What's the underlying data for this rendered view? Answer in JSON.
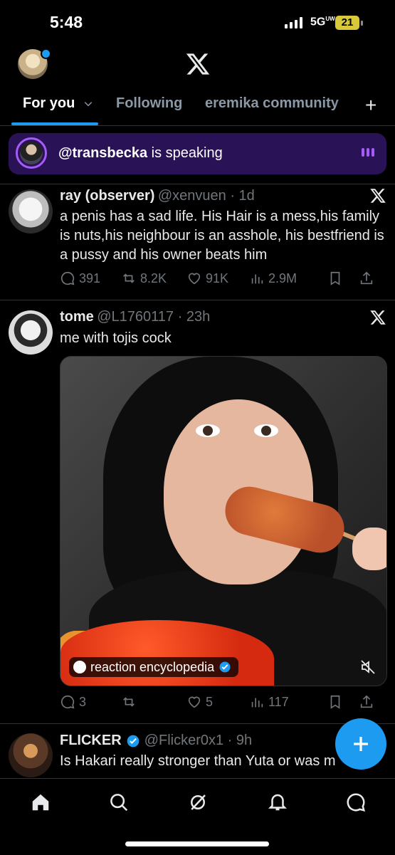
{
  "status_bar": {
    "time": "5:48",
    "network": "5G",
    "network_super": "UW",
    "battery": "21"
  },
  "tabs": [
    {
      "label": "For you",
      "active": true
    },
    {
      "label": "Following",
      "active": false
    },
    {
      "label": "eremika community",
      "active": false
    }
  ],
  "space": {
    "handle": "@transbecka",
    "text": " is speaking"
  },
  "tweets": [
    {
      "name": "ray (observer)",
      "handle": "@xenvuen · 1d",
      "body": "a penis has a sad life. His Hair is a mess,his family is nuts,his neighbour is an asshole, his bestfriend is a pussy and his owner beats him",
      "replies": "391",
      "reposts": "8.2K",
      "likes": "91K",
      "views": "2.9M"
    },
    {
      "name": "tome",
      "handle": "@L1760117 · 23h",
      "body": "me with tojis cock",
      "media_badge": "reaction encyclopedia",
      "replies": "3",
      "reposts": "",
      "likes": "5",
      "views": "117"
    },
    {
      "name": "FLICKER",
      "handle": "@Flicker0x1 · 9h",
      "body": "Is Hakari really stronger than Yuta or was m"
    }
  ],
  "colors": {
    "accent": "#1d9bf0",
    "space_bg": "#2a1257",
    "space_accent": "#a65cf8",
    "verified": "#1d9bf0"
  },
  "icons": {
    "header": "x-logo",
    "nav": [
      "home-icon",
      "search-icon",
      "grok-icon",
      "notifications-icon",
      "messages-icon"
    ],
    "fab": "plus-icon"
  }
}
